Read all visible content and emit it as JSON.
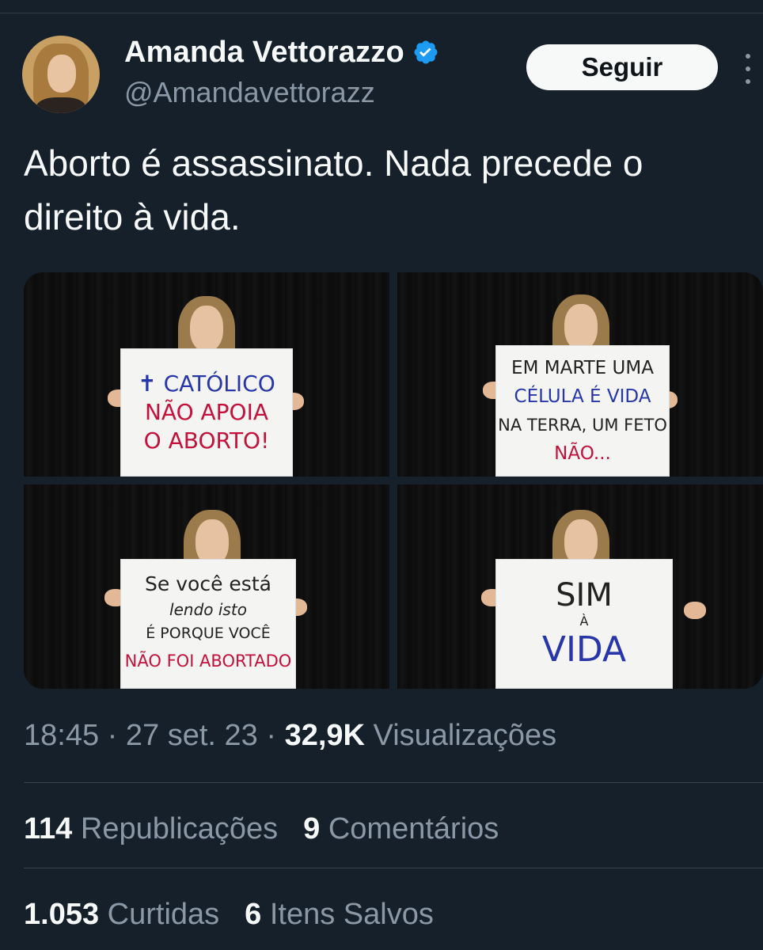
{
  "author": {
    "display_name": "Amanda Vettorazzo",
    "handle": "@Amandavettorazz",
    "verified": true,
    "verified_color": "#1d9bf0"
  },
  "follow_button": {
    "label": "Seguir"
  },
  "tweet": {
    "text": "Aborto é assassinato. Nada precede o\ndireito à vida."
  },
  "media": [
    {
      "sign_lines": [
        "✝ CATÓLICO",
        "NÃO APOIA",
        "O ABORTO!"
      ]
    },
    {
      "sign_lines": [
        "EM MARTE UMA",
        "CÉLULA É VIDA",
        "NA TERRA, UM FETO",
        "NÃO..."
      ]
    },
    {
      "sign_lines": [
        "Se você está",
        "lendo isto",
        "É PORQUE VOCÊ",
        "NÃO FOI ABORTADO"
      ]
    },
    {
      "sign_lines": [
        "SIM",
        "À",
        "VIDA"
      ]
    }
  ],
  "meta": {
    "time": "18:45",
    "separator": "·",
    "date": "27 set. 23",
    "views_count": "32,9K",
    "views_label": "Visualizações"
  },
  "stats": {
    "reposts_count": "114",
    "reposts_label": "Republicações",
    "comments_count": "9",
    "comments_label": "Comentários",
    "likes_count": "1.053",
    "likes_label": "Curtidas",
    "saves_count": "6",
    "saves_label": "Itens Salvos"
  },
  "colors": {
    "background": "#15202b",
    "primary_text": "#f7f9f9",
    "secondary_text": "#8b98a5",
    "divider": "#38444d",
    "sign_red": "#c2123b",
    "sign_blue": "#2736a8"
  }
}
